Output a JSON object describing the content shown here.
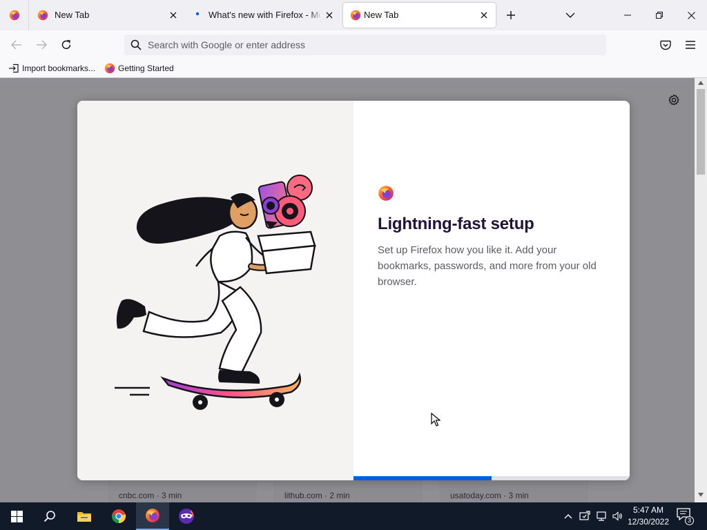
{
  "browser": {
    "menu_icon": "firefox-logo-icon",
    "tabs": [
      {
        "title": "New Tab",
        "favicon": "firefox-logo-icon",
        "active": false
      },
      {
        "title": "What's new with Firefox - More",
        "favicon": "loading-dot-icon",
        "active": false
      },
      {
        "title": "New Tab",
        "favicon": "firefox-logo-icon",
        "active": true
      }
    ],
    "new_tab_icon": "plus-icon",
    "tab_list_icon": "chevron-down-icon",
    "window_controls": [
      "minimize-icon",
      "restore-icon",
      "close-icon"
    ]
  },
  "navbar": {
    "back_icon": "back-arrow-icon",
    "forward_icon": "forward-arrow-icon",
    "reload_icon": "reload-icon",
    "search_placeholder": "Search with Google or enter address",
    "url_value": "",
    "pocket_icon": "pocket-icon",
    "menu_icon": "hamburger-menu-icon"
  },
  "bookmarks": {
    "items": [
      {
        "label": "Import bookmarks...",
        "icon": "import-icon"
      },
      {
        "label": "Getting Started",
        "icon": "firefox-logo-icon"
      }
    ]
  },
  "newtab": {
    "settings_icon": "gear-icon",
    "stories": [
      {
        "source": "cnbc.com · 3 min"
      },
      {
        "source": "lithub.com · 2 min"
      },
      {
        "source": "usatoday.com · 3 min"
      }
    ]
  },
  "onboarding": {
    "title": "Lightning-fast setup",
    "subtitle": "Set up Firefox how you like it. Add your bookmarks, passwords, and more from your old browser.",
    "progress": 0.5,
    "progress_color": "#0060df",
    "illustration": "woman-skateboarding-with-box-illustration"
  },
  "taskbar": {
    "apps": [
      "windows-start-icon",
      "search-icon",
      "file-explorer-icon",
      "chrome-icon",
      "firefox-icon",
      "privacy-mask-icon"
    ],
    "active_app": "firefox-icon",
    "tray": [
      "chevron-up-icon",
      "update-icon",
      "network-icon",
      "volume-icon"
    ],
    "time": "5:47 AM",
    "date": "12/30/2022",
    "notification_count": "3"
  }
}
